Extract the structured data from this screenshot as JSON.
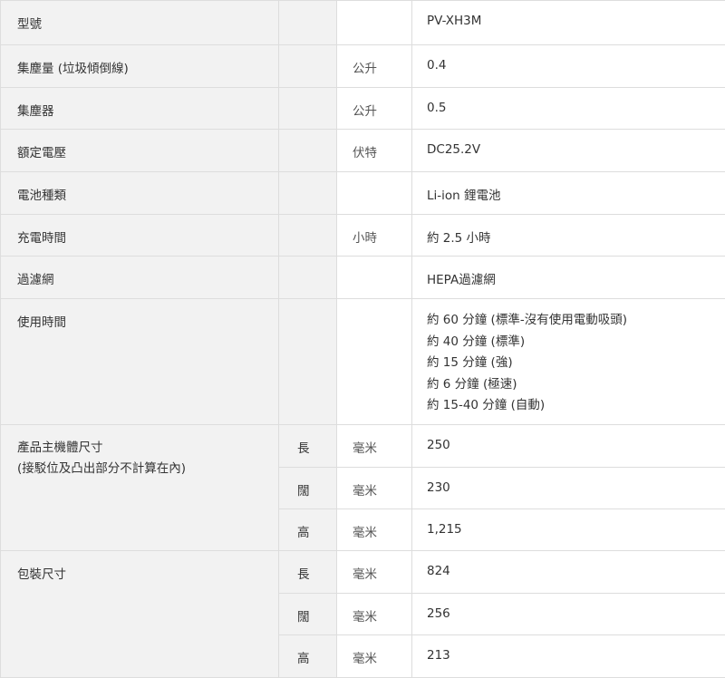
{
  "rows": [
    {
      "label": "型號",
      "unit": "",
      "value": "PV-XH3M"
    },
    {
      "label": "集塵量 (垃圾傾倒線)",
      "unit": "公升",
      "value": "0.4"
    },
    {
      "label": "集塵器",
      "unit": "公升",
      "value": "0.5"
    },
    {
      "label": "額定電壓",
      "unit": "伏特",
      "value": "DC25.2V"
    },
    {
      "label": "電池種類",
      "unit": "",
      "value": "Li-ion 鋰電池"
    },
    {
      "label": "充電時間",
      "unit": "小時",
      "value": "約 2.5 小時"
    },
    {
      "label": "過濾網",
      "unit": "",
      "value": "HEPA過濾網"
    }
  ],
  "usage": {
    "label": "使用時間",
    "values": [
      "約 60 分鐘 (標準-沒有使用電動吸頭)",
      "約 40 分鐘 (標準)",
      "約 15 分鐘 (強)",
      "約 6 分鐘 (極速)",
      "約 15-40 分鐘 (自動)"
    ]
  },
  "body_size": {
    "label_line1": "產品主機體尺寸",
    "label_line2": "(接駁位及凸出部分不計算在內)",
    "rows": [
      {
        "dim": "長",
        "unit": "毫米",
        "value": "250"
      },
      {
        "dim": "闊",
        "unit": "毫米",
        "value": "230"
      },
      {
        "dim": "高",
        "unit": "毫米",
        "value": "1,215"
      }
    ]
  },
  "package_size": {
    "label": "包裝尺寸",
    "rows": [
      {
        "dim": "長",
        "unit": "毫米",
        "value": "824"
      },
      {
        "dim": "闊",
        "unit": "毫米",
        "value": "256"
      },
      {
        "dim": "高",
        "unit": "毫米",
        "value": "213"
      }
    ]
  }
}
